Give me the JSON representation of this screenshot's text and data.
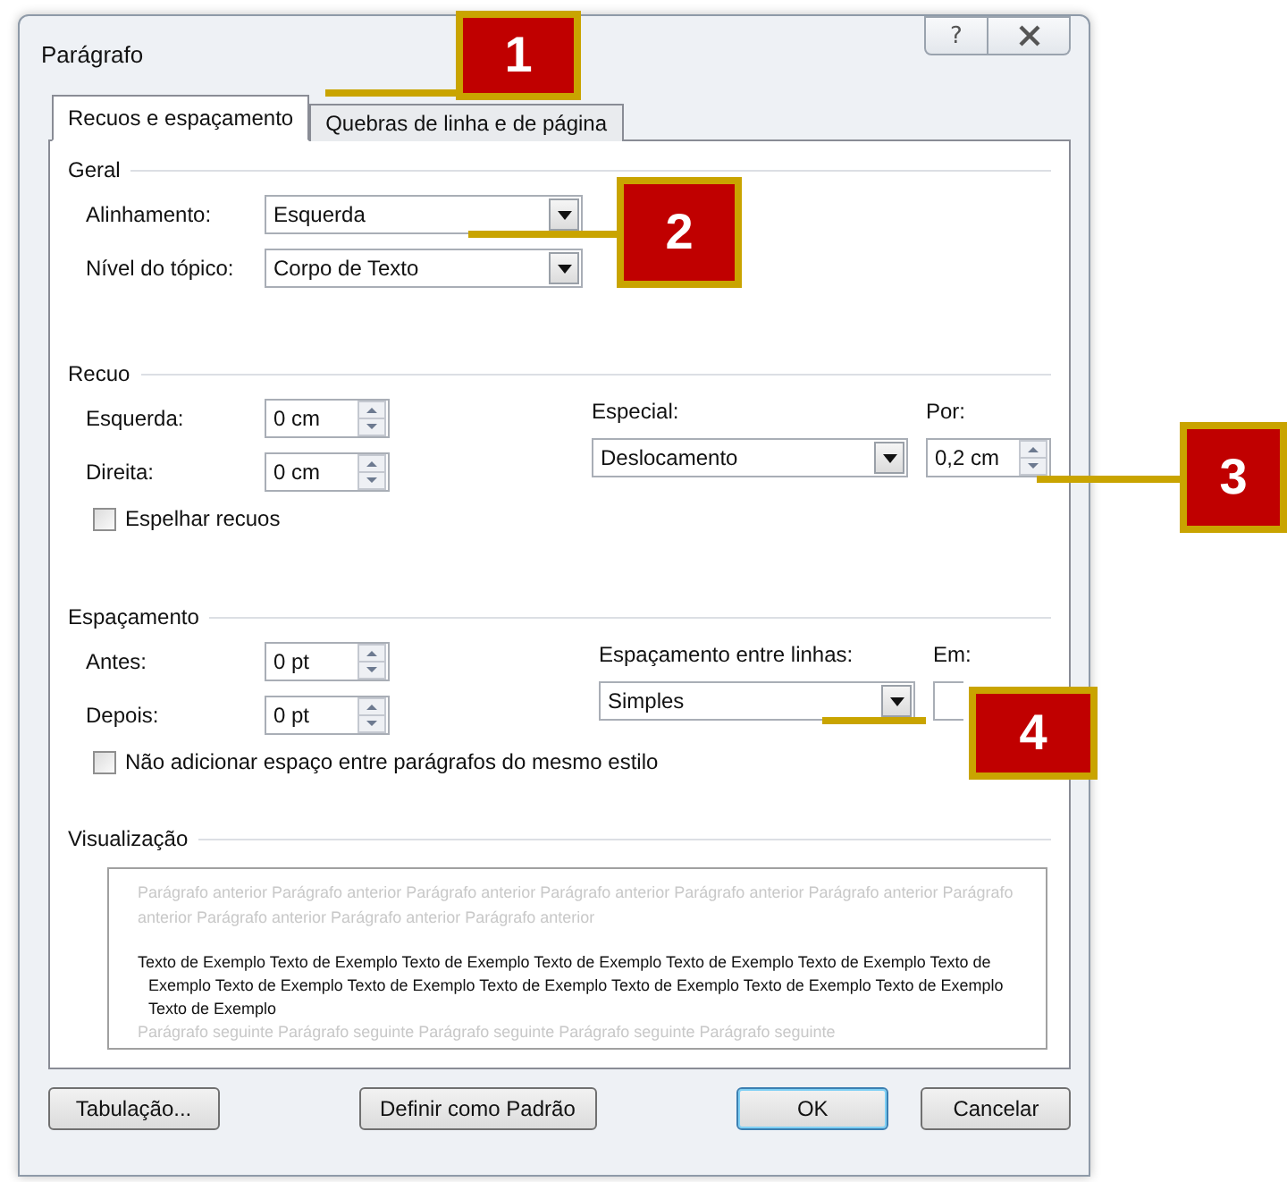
{
  "window": {
    "title": "Parágrafo",
    "help": "?"
  },
  "tabs": [
    {
      "label": "Recuos e espaçamento",
      "selected": true
    },
    {
      "label": "Quebras de linha e de página",
      "selected": false
    }
  ],
  "general": {
    "title": "Geral",
    "fields": [
      {
        "label": "Alinhamento:",
        "value": "Esquerda"
      },
      {
        "label": "Nível do tópico:",
        "value": "Corpo de Texto"
      }
    ]
  },
  "indent": {
    "title": "Recuo",
    "left": {
      "label": "Esquerda:",
      "value": "0 cm"
    },
    "right": {
      "label": "Direita:",
      "value": "0 cm"
    },
    "special": {
      "label": "Especial:",
      "value": "Deslocamento"
    },
    "by": {
      "label": "Por:",
      "value": "0,2 cm"
    },
    "mirror": {
      "label": "Espelhar recuos",
      "checked": false
    }
  },
  "spacing": {
    "title": "Espaçamento",
    "before": {
      "label": "Antes:",
      "value": "0 pt"
    },
    "after": {
      "label": "Depois:",
      "value": "0 pt"
    },
    "line": {
      "label": "Espaçamento entre linhas:",
      "value": "Simples"
    },
    "at": {
      "label": "Em:"
    },
    "no_space": {
      "label": "Não adicionar espaço entre parágrafos do mesmo estilo",
      "checked": false
    }
  },
  "preview": {
    "title": "Visualização",
    "previous": "Parágrafo anterior Parágrafo anterior Parágrafo anterior Parágrafo anterior Parágrafo anterior Parágrafo anterior Parágrafo anterior Parágrafo anterior Parágrafo anterior Parágrafo anterior",
    "sample": "Texto de Exemplo Texto de Exemplo Texto de Exemplo Texto de Exemplo Texto de Exemplo Texto de Exemplo Texto de Exemplo Texto de Exemplo Texto de Exemplo Texto de Exemplo Texto de Exemplo Texto de Exemplo Texto de Exemplo Texto de Exemplo",
    "next": "Parágrafo seguinte Parágrafo seguinte Parágrafo seguinte Parágrafo seguinte Parágrafo seguinte"
  },
  "buttons": [
    {
      "label": "Tabulação...",
      "default": false
    },
    {
      "label": "Definir como Padrão",
      "default": false
    },
    {
      "label": "OK",
      "default": true
    },
    {
      "label": "Cancelar",
      "default": false
    }
  ],
  "callouts": [
    "1",
    "2",
    "3",
    "4"
  ]
}
